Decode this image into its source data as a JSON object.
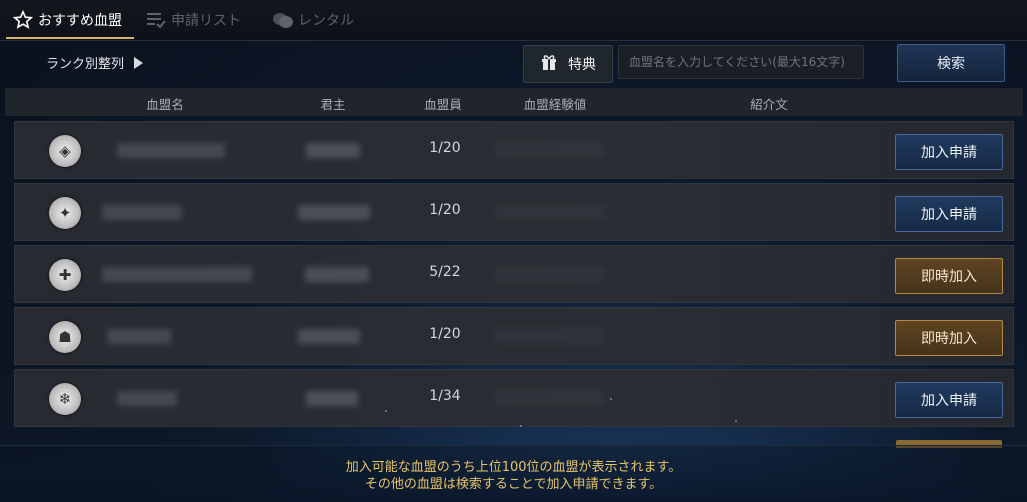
{
  "tabs": [
    {
      "label": "おすすめ血盟",
      "icon": "star-icon",
      "active": true
    },
    {
      "label": "申請リスト",
      "icon": "list-check-icon",
      "active": false
    },
    {
      "label": "レンタル",
      "icon": "coins-icon",
      "active": false
    }
  ],
  "toolbar": {
    "rank_sort_label": "ランク別整列",
    "perk_label": "特典",
    "search_placeholder": "血盟名を入力してください(最大16文字)",
    "search_button_label": "検索"
  },
  "table": {
    "headers": [
      "血盟名",
      "君主",
      "血盟員",
      "血盟経験値",
      "紹介文"
    ],
    "rows": [
      {
        "emblem_icon": "shield-crest-icon",
        "members": "1/20",
        "action": "加入申請",
        "action_type": "apply"
      },
      {
        "emblem_icon": "winged-crest-icon",
        "members": "1/20",
        "action": "加入申請",
        "action_type": "apply"
      },
      {
        "emblem_icon": "cross-flag-crest-icon",
        "members": "5/22",
        "action": "即時加入",
        "action_type": "join"
      },
      {
        "emblem_icon": "helmet-crest-icon",
        "members": "1/20",
        "action": "即時加入",
        "action_type": "join"
      },
      {
        "emblem_icon": "snowflake-crest-icon",
        "members": "1/34",
        "action": "加入申請",
        "action_type": "apply"
      }
    ]
  },
  "footer": {
    "line1": "加入可能な血盟のうち上位100位の血盟が表示されます。",
    "line2": "その他の血盟は検索することで加入申請できます。"
  },
  "colors": {
    "accent_gold": "#e7c46a",
    "apply_blue": "#203a5e",
    "join_gold": "#5e4522"
  }
}
